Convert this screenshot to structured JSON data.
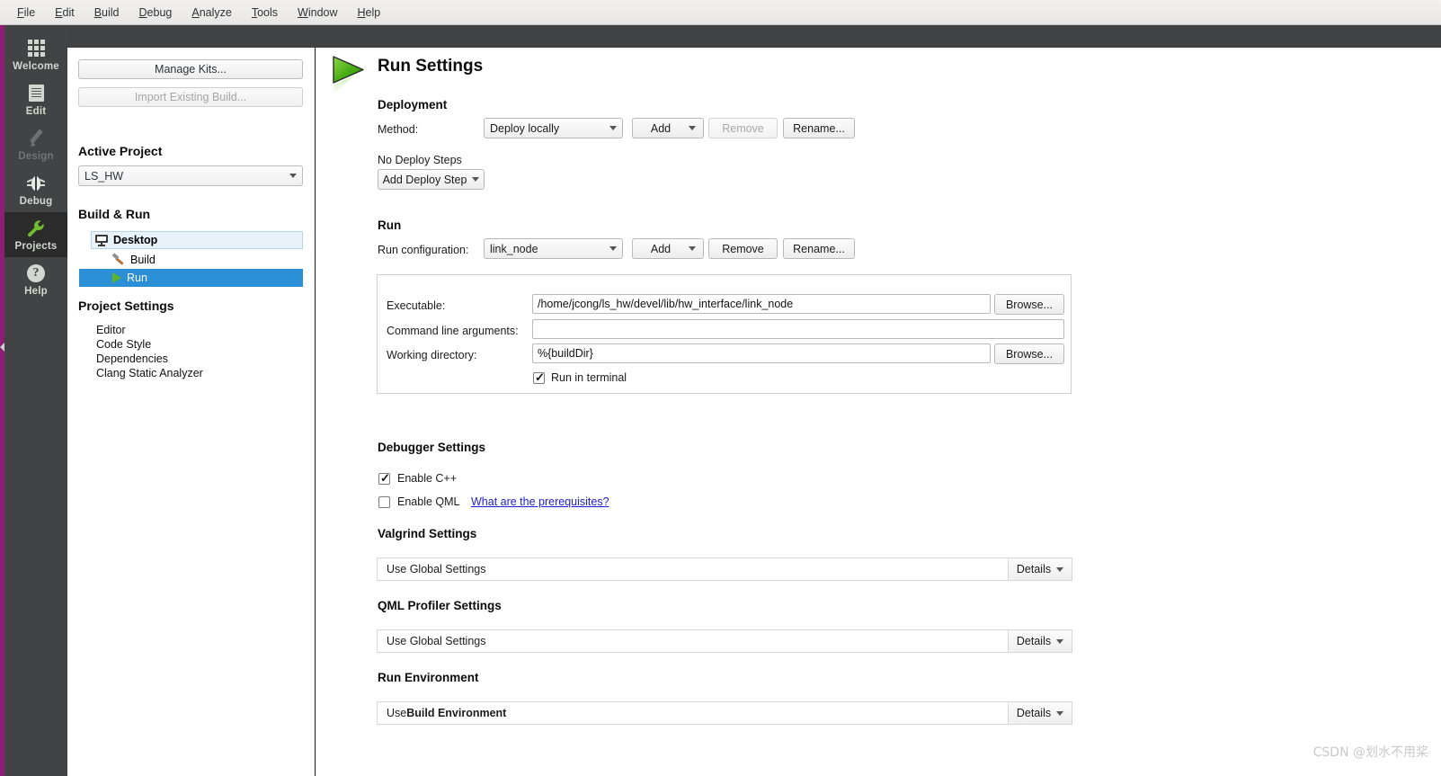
{
  "menubar": {
    "items": [
      {
        "label": "File",
        "accel": "F"
      },
      {
        "label": "Edit",
        "accel": "E"
      },
      {
        "label": "Build",
        "accel": "B"
      },
      {
        "label": "Debug",
        "accel": "D"
      },
      {
        "label": "Analyze",
        "accel": "A"
      },
      {
        "label": "Tools",
        "accel": "T"
      },
      {
        "label": "Window",
        "accel": "W"
      },
      {
        "label": "Help",
        "accel": "H"
      }
    ]
  },
  "modebar": {
    "items": [
      {
        "label": "Welcome",
        "icon": "grid-icon",
        "state": "normal"
      },
      {
        "label": "Edit",
        "icon": "document-icon",
        "state": "normal"
      },
      {
        "label": "Design",
        "icon": "pencil-icon",
        "state": "disabled"
      },
      {
        "label": "Debug",
        "icon": "bug-icon",
        "state": "normal"
      },
      {
        "label": "Projects",
        "icon": "wrench-icon",
        "state": "active"
      },
      {
        "label": "Help",
        "icon": "question-icon",
        "state": "normal"
      }
    ]
  },
  "sidebar": {
    "manage_kits_label": "Manage Kits...",
    "import_existing_build_label": "Import Existing Build...",
    "active_project_heading": "Active Project",
    "active_project_value": "LS_HW",
    "build_run_heading": "Build & Run",
    "tree": [
      {
        "label": "Desktop",
        "icon": "monitor-icon",
        "state": "kit"
      },
      {
        "label": "Build",
        "icon": "hammer-icon",
        "state": "normal"
      },
      {
        "label": "Run",
        "icon": "play-icon",
        "state": "selected"
      }
    ],
    "project_settings_heading": "Project Settings",
    "project_settings_items": [
      "Editor",
      "Code Style",
      "Dependencies",
      "Clang Static Analyzer"
    ]
  },
  "main": {
    "title": "Run Settings",
    "title_icon": "green-play-icon",
    "deployment": {
      "heading": "Deployment",
      "method_label": "Method:",
      "method_value": "Deploy locally",
      "add_label": "Add",
      "remove_label": "Remove",
      "rename_label": "Rename...",
      "no_deploy_steps_label": "No Deploy Steps",
      "add_deploy_step_label": "Add Deploy Step"
    },
    "run": {
      "heading": "Run",
      "run_configuration_label": "Run configuration:",
      "run_configuration_value": "link_node",
      "add_label": "Add",
      "remove_label": "Remove",
      "rename_label": "Rename...",
      "executable_label": "Executable:",
      "executable_value": "/home/jcong/ls_hw/devel/lib/hw_interface/link_node",
      "command_line_arguments_label": "Command line arguments:",
      "command_line_arguments_value": "",
      "working_directory_label": "Working directory:",
      "working_directory_value": "%{buildDir}",
      "browse_label": "Browse...",
      "run_in_terminal_label": "Run in terminal",
      "run_in_terminal_checked": true
    },
    "debugger": {
      "heading": "Debugger Settings",
      "enable_cpp_label": "Enable C++",
      "enable_cpp_checked": true,
      "enable_qml_label": "Enable QML",
      "enable_qml_checked": false,
      "prerequisites_link": "What are the prerequisites?"
    },
    "valgrind": {
      "heading": "Valgrind Settings",
      "value": "Use Global Settings",
      "details_label": "Details"
    },
    "qml_profiler": {
      "heading": "QML Profiler Settings",
      "value": "Use Global Settings",
      "details_label": "Details"
    },
    "run_environment": {
      "heading": "Run Environment",
      "value_prefix": "Use ",
      "value_strong": "Build Environment",
      "details_label": "Details"
    }
  },
  "watermark": "CSDN @划水不用桨",
  "colors": {
    "accent_purple": "#8f1d76",
    "dark_header": "#404244",
    "mode_bar": "#414345",
    "selection_blue": "#2a8fd4",
    "kit_highlight": "#e8f2fb",
    "play_green": "#5eb32b",
    "link_blue": "#2020d0"
  }
}
